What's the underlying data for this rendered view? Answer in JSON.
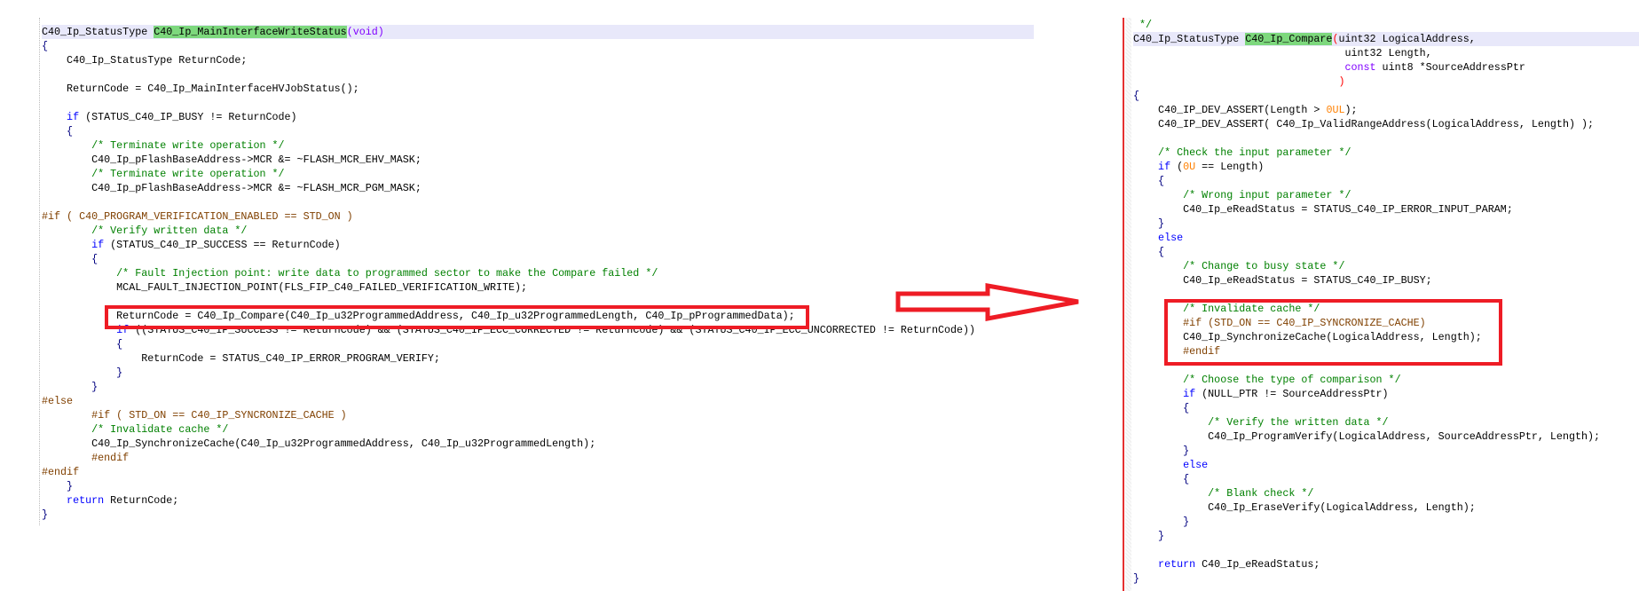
{
  "left_panel": {
    "lines": [
      [
        [
          "",
          "C40_Ip_StatusType "
        ],
        [
          "fn",
          "C40_Ip_MainInterfaceWriteStatus"
        ],
        [
          "ty",
          "(void)"
        ]
      ],
      [
        [
          "op",
          "{"
        ]
      ],
      [
        [
          "",
          "    C40_Ip_StatusType ReturnCode;"
        ]
      ],
      [],
      [
        [
          "",
          "    ReturnCode = C40_Ip_MainInterfaceHVJobStatus();"
        ]
      ],
      [],
      [
        [
          "kw",
          "    if"
        ],
        [
          "",
          " (STATUS_C40_IP_BUSY != ReturnCode)"
        ]
      ],
      [
        [
          "op",
          "    {"
        ]
      ],
      [
        [
          "cm",
          "        /* Terminate write operation */"
        ]
      ],
      [
        [
          "",
          "        C40_Ip_pFlashBaseAddress->MCR &= ~FLASH_MCR_EHV_MASK;"
        ]
      ],
      [
        [
          "cm",
          "        /* Terminate write operation */"
        ]
      ],
      [
        [
          "",
          "        C40_Ip_pFlashBaseAddress->MCR &= ~FLASH_MCR_PGM_MASK;"
        ]
      ],
      [],
      [
        [
          "pp",
          "#if ( C40_PROGRAM_VERIFICATION_ENABLED == STD_ON )"
        ]
      ],
      [
        [
          "cm",
          "        /* Verify written data */"
        ]
      ],
      [
        [
          "kw",
          "        if"
        ],
        [
          "",
          " (STATUS_C40_IP_SUCCESS == ReturnCode)"
        ]
      ],
      [
        [
          "op",
          "        {"
        ]
      ],
      [
        [
          "cm",
          "            /* Fault Injection point: write data to programmed sector to make the Compare failed */"
        ]
      ],
      [
        [
          "",
          "            MCAL_FAULT_INJECTION_POINT(FLS_FIP_C40_FAILED_VERIFICATION_WRITE);"
        ]
      ],
      [],
      [
        [
          "",
          "            ReturnCode = C40_Ip_Compare(C40_Ip_u32ProgrammedAddress, C40_Ip_u32ProgrammedLength, C40_Ip_pProgrammedData);"
        ]
      ],
      [
        [
          "kw",
          "            if"
        ],
        [
          "",
          " ((STATUS_C40_IP_SUCCESS != ReturnCode) && (STATUS_C40_IP_ECC_CORRECTED != ReturnCode) && (STATUS_C40_IP_ECC_UNCORRECTED != ReturnCode))"
        ]
      ],
      [
        [
          "op",
          "            {"
        ]
      ],
      [
        [
          "",
          "                ReturnCode = STATUS_C40_IP_ERROR_PROGRAM_VERIFY;"
        ]
      ],
      [
        [
          "op",
          "            }"
        ]
      ],
      [
        [
          "op",
          "        }"
        ]
      ],
      [
        [
          "pp",
          "#else"
        ]
      ],
      [
        [
          "pp",
          "        #if ( STD_ON == C40_IP_SYNCRONIZE_CACHE )"
        ]
      ],
      [
        [
          "cm",
          "        /* Invalidate cache */"
        ]
      ],
      [
        [
          "",
          "        C40_Ip_SynchronizeCache(C40_Ip_u32ProgrammedAddress, C40_Ip_u32ProgrammedLength);"
        ]
      ],
      [
        [
          "pp",
          "        #endif"
        ]
      ],
      [
        [
          "pp",
          "#endif"
        ]
      ],
      [
        [
          "op",
          "    }"
        ]
      ],
      [
        [
          "kw",
          "    return"
        ],
        [
          "",
          " ReturnCode;"
        ]
      ],
      [
        [
          "op",
          "}"
        ]
      ]
    ]
  },
  "right_panel": {
    "lines": [
      [
        [
          "cm",
          " */"
        ]
      ],
      [
        [
          "",
          "C40_Ip_StatusType "
        ],
        [
          "fn",
          "C40_Ip_Compare"
        ],
        [
          "par",
          "("
        ],
        [
          "",
          "uint32 LogicalAddress,"
        ]
      ],
      [
        [
          "",
          "                                  uint32 Length,"
        ]
      ],
      [
        [
          "ty",
          "                                  const"
        ],
        [
          "",
          " uint8 *SourceAddressPtr"
        ]
      ],
      [
        [
          "par",
          "                                 )"
        ]
      ],
      [
        [
          "op",
          "{"
        ]
      ],
      [
        [
          "",
          "    C40_IP_DEV_ASSERT(Length > "
        ],
        [
          "num",
          "0UL"
        ],
        [
          "",
          ");"
        ]
      ],
      [
        [
          "",
          "    C40_IP_DEV_ASSERT( C40_Ip_ValidRangeAddress(LogicalAddress, Length) );"
        ]
      ],
      [],
      [
        [
          "cm",
          "    /* Check the input parameter */"
        ]
      ],
      [
        [
          "kw",
          "    if"
        ],
        [
          "",
          " ("
        ],
        [
          "num",
          "0U"
        ],
        [
          "",
          " == Length)"
        ]
      ],
      [
        [
          "op",
          "    {"
        ]
      ],
      [
        [
          "cm",
          "        /* Wrong input parameter */"
        ]
      ],
      [
        [
          "",
          "        C40_Ip_eReadStatus = STATUS_C40_IP_ERROR_INPUT_PARAM;"
        ]
      ],
      [
        [
          "op",
          "    }"
        ]
      ],
      [
        [
          "kw",
          "    else"
        ]
      ],
      [
        [
          "op",
          "    {"
        ]
      ],
      [
        [
          "cm",
          "        /* Change to busy state */"
        ]
      ],
      [
        [
          "",
          "        C40_Ip_eReadStatus = STATUS_C40_IP_BUSY;"
        ]
      ],
      [],
      [
        [
          "cm",
          "        /* Invalidate cache */"
        ]
      ],
      [
        [
          "pp",
          "        #if (STD_ON == C40_IP_SYNCRONIZE_CACHE)"
        ]
      ],
      [
        [
          "",
          "        C40_Ip_SynchronizeCache(LogicalAddress, Length);"
        ]
      ],
      [
        [
          "pp",
          "        #endif"
        ]
      ],
      [],
      [
        [
          "cm",
          "        /* Choose the type of comparison */"
        ]
      ],
      [
        [
          "kw",
          "        if"
        ],
        [
          "",
          " (NULL_PTR != SourceAddressPtr)"
        ]
      ],
      [
        [
          "op",
          "        {"
        ]
      ],
      [
        [
          "cm",
          "            /* Verify the written data */"
        ]
      ],
      [
        [
          "",
          "            C40_Ip_ProgramVerify(LogicalAddress, SourceAddressPtr, Length);"
        ]
      ],
      [
        [
          "op",
          "        }"
        ]
      ],
      [
        [
          "kw",
          "        else"
        ]
      ],
      [
        [
          "op",
          "        {"
        ]
      ],
      [
        [
          "cm",
          "            /* Blank check */"
        ]
      ],
      [
        [
          "",
          "            C40_Ip_EraseVerify(LogicalAddress, Length);"
        ]
      ],
      [
        [
          "op",
          "        }"
        ]
      ],
      [
        [
          "op",
          "    }"
        ]
      ],
      [],
      [
        [
          "kw",
          "    return"
        ],
        [
          "",
          " C40_Ip_eReadStatus;"
        ]
      ],
      [
        [
          "op",
          "}"
        ]
      ]
    ]
  },
  "colors": {
    "highlight_box": "#ee1c25",
    "arrow": "#ee1c25",
    "function_name_bg": "#7dd87d"
  }
}
